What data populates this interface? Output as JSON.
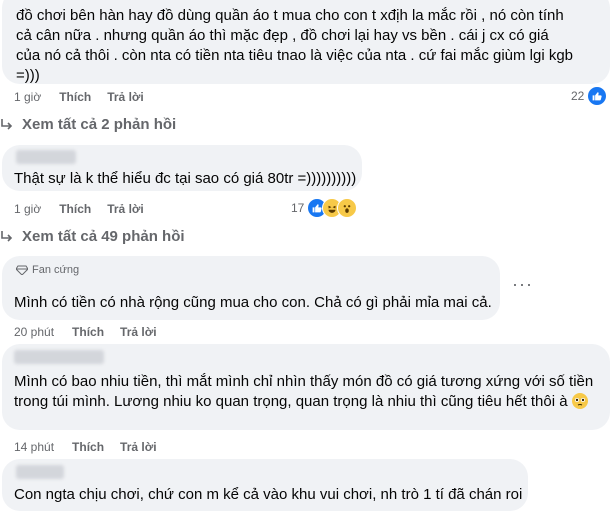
{
  "comments": [
    {
      "text": "đồ chơi bên hàn hay đồ dùng quần áo t mua cho con t xđịh la mắc rồi , nó còn tính cả cân nữa . nhưng quần áo thì mặc đẹp , đồ chơi lại hay vs bền . cái j cx có giá của nó cả thôi . còn nta có tiền nta tiêu tnao là việc của nta . cứ fai mắc giùm lgi kgb =)))",
      "time": "1 giờ",
      "like": "Thích",
      "reply": "Trả lời",
      "reactions": "22"
    },
    {
      "text": "Thật sự là k thể hiểu đc tại sao có giá 80tr =))))))))))",
      "time": "1 giờ",
      "like": "Thích",
      "reply": "Trả lời",
      "reactions": "17"
    },
    {
      "badge": "Fan cứng",
      "text": "Mình có tiền có nhà rộng cũng mua cho con. Chả có gì phải mỉa mai cả.",
      "time": "20 phút",
      "like": "Thích",
      "reply": "Trả lời"
    },
    {
      "text": "Mình có bao nhiu tiền, thì mắt mình chỉ nhìn thấy món đồ có giá tương xứng với số tiền trong túi mình. Lương nhiu ko quan trọng, quan trọng là nhiu thì cũng tiêu hết thôi à",
      "time": "14 phút",
      "like": "Thích",
      "reply": "Trả lời"
    },
    {
      "text": "Con ngta chịu chơi, chứ con m kể cả vào khu vui chơi, nh trò 1 tí đã chán roi"
    }
  ],
  "view_replies_1": "Xem tất cả 2 phản hồi",
  "view_replies_2": "Xem tất cả 49 phản hồi",
  "colors": {
    "like_blue": "#1877f2",
    "bubble": "#f0f2f5",
    "meta": "#65676b"
  }
}
